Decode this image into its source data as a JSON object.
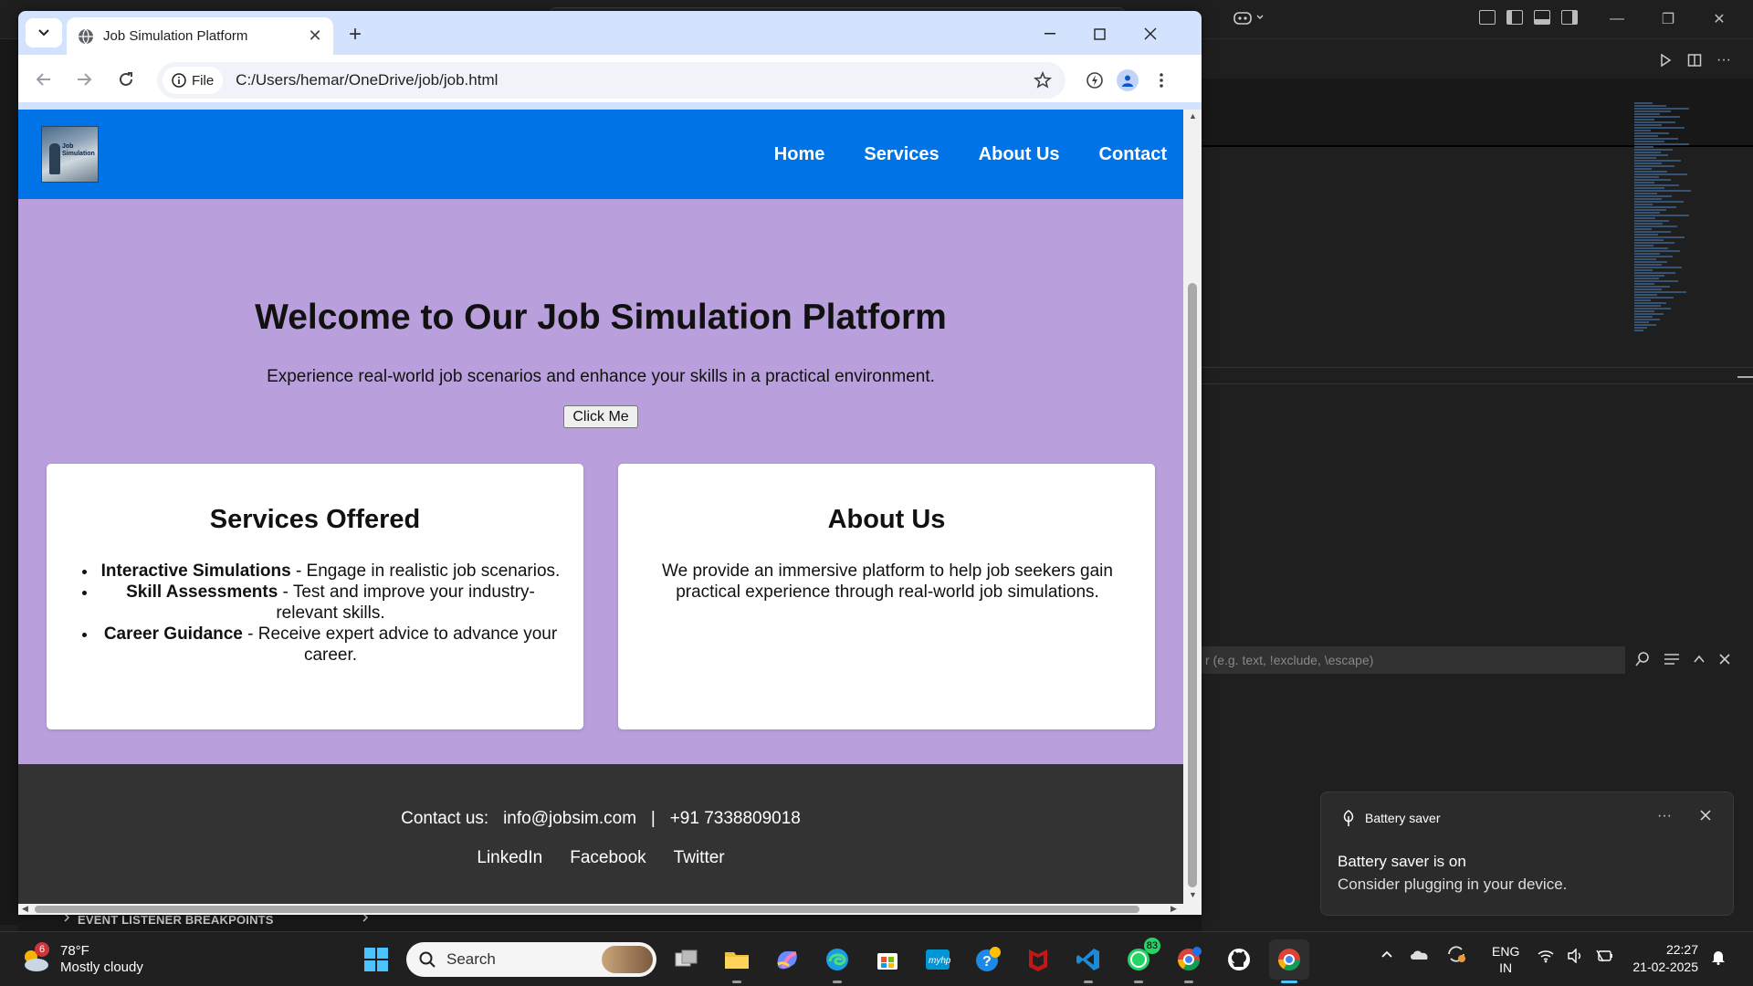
{
  "browser": {
    "tab_title": "Job Simulation Platform",
    "site_chip": "File",
    "url": "C:/Users/hemar/OneDrive/job/job.html"
  },
  "site": {
    "nav": [
      "Home",
      "Services",
      "About Us",
      "Contact"
    ],
    "hero": {
      "title": "Welcome to Our Job Simulation Platform",
      "subtitle": "Experience real-world job scenarios and enhance your skills in a practical environment.",
      "button": "Click Me"
    },
    "services": {
      "title": "Services Offered",
      "items": [
        {
          "name": "Interactive Simulations",
          "desc": " - Engage in realistic job scenarios."
        },
        {
          "name": "Skill Assessments",
          "desc": " - Test and improve your industry-relevant skills."
        },
        {
          "name": "Career Guidance",
          "desc": " - Receive expert advice to advance your career."
        }
      ]
    },
    "about": {
      "title": "About Us",
      "text": "We provide an immersive platform to help job seekers gain practical experience through real-world job simulations."
    },
    "footer": {
      "contact_label": "Contact us:",
      "email": "info@jobsim.com",
      "separator": "|",
      "phone": "+91 7338809018",
      "social": [
        "LinkedIn",
        "Facebook",
        "Twitter"
      ]
    }
  },
  "vscode": {
    "filter_placeholder": "r (e.g. text, !exclude, \\escape)",
    "bottom_section": "EVENT LISTENER BREAKPOINTS"
  },
  "toast": {
    "app": "Battery saver",
    "title": "Battery saver is on",
    "body": "Consider plugging in your device."
  },
  "taskbar": {
    "weather_temp": "78°F",
    "weather_desc": "Mostly cloudy",
    "weather_badge": "6",
    "search_label": "Search",
    "whatsapp_badge": "83",
    "lang_top": "ENG",
    "lang_bottom": "IN",
    "time": "22:27",
    "date": "21-02-2025"
  },
  "colors": {
    "site_header": "#0073e6",
    "page_bg": "#b9a0dc",
    "footer_bg": "#333333",
    "chrome_frame": "#d3e3fd"
  }
}
